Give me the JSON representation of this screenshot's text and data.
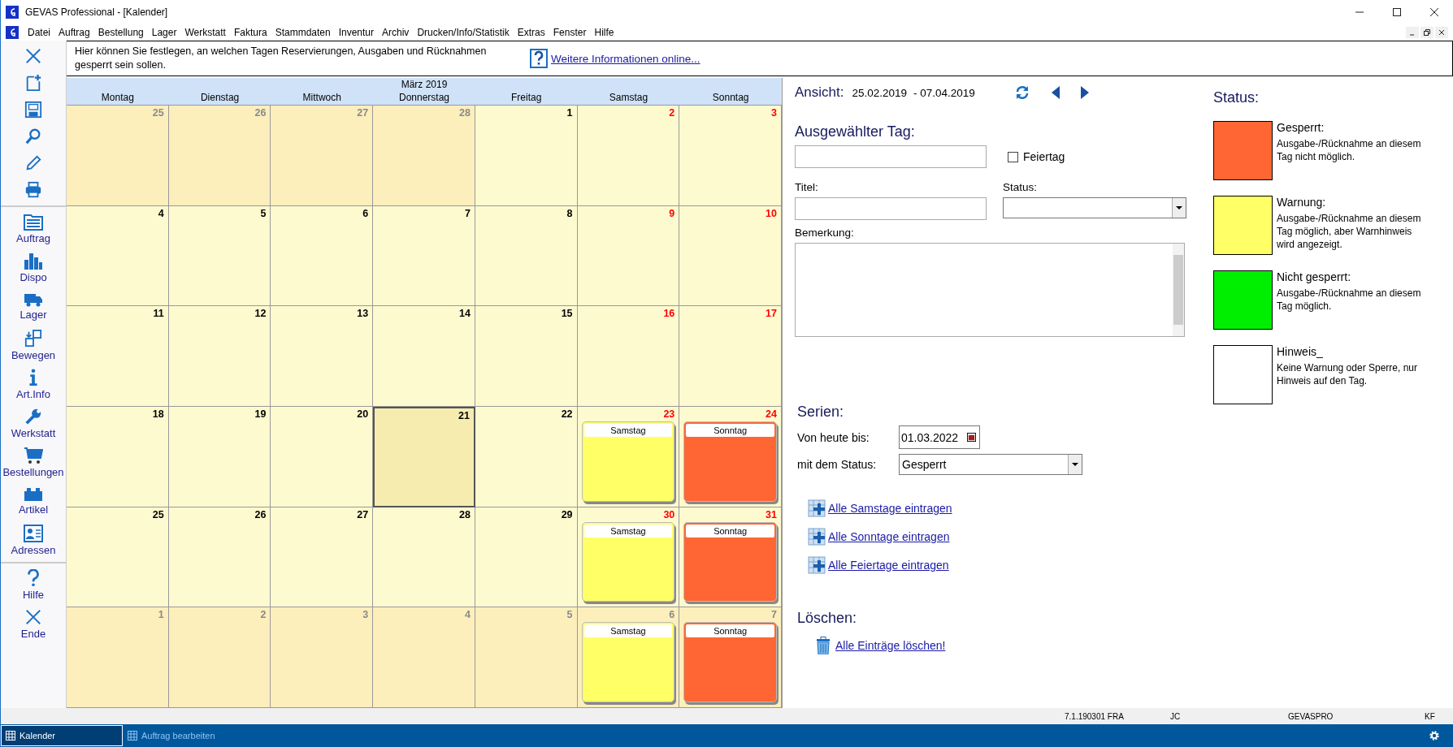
{
  "window": {
    "title": "GEVAS Professional - [Kalender]"
  },
  "menu": [
    {
      "label": "Datei"
    },
    {
      "label": "Auftrag"
    },
    {
      "label": "Bestellung"
    },
    {
      "label": "Lager"
    },
    {
      "label": "Werkstatt"
    },
    {
      "label": "Faktura"
    },
    {
      "label": "Stammdaten"
    },
    {
      "label": "Inventur"
    },
    {
      "label": "Archiv"
    },
    {
      "label": "Drucken/Info/Statistik"
    },
    {
      "label": "Extras"
    },
    {
      "label": "Fenster"
    },
    {
      "label": "Hilfe"
    }
  ],
  "sidebar": {
    "items": [
      {
        "label": "Auftrag"
      },
      {
        "label": "Dispo"
      },
      {
        "label": "Lager"
      },
      {
        "label": "Bewegen"
      },
      {
        "label": "Art.Info"
      },
      {
        "label": "Werkstatt"
      },
      {
        "label": "Bestellungen"
      },
      {
        "label": "Artikel"
      },
      {
        "label": "Adressen"
      }
    ],
    "bottom_items": [
      {
        "label": "Hilfe"
      },
      {
        "label": "Ende"
      }
    ]
  },
  "info_bar": {
    "text": "Hier können Sie festlegen, an welchen Tagen Reservierungen, Ausgaben und Rücknahmen gesperrt sein sollen.",
    "link": "Weitere Informationen online..."
  },
  "calendar": {
    "month": "März 2019",
    "weekdays": [
      "Montag",
      "Dienstag",
      "Mittwoch",
      "Donnerstag",
      "Freitag",
      "Samstag",
      "Sonntag"
    ],
    "weeks": [
      [
        {
          "day": "25",
          "in_month": false,
          "selected": false
        },
        {
          "day": "26",
          "in_month": false,
          "selected": false
        },
        {
          "day": "27",
          "in_month": false,
          "selected": false
        },
        {
          "day": "28",
          "in_month": false,
          "selected": false
        },
        {
          "day": "1",
          "in_month": true,
          "selected": false
        },
        {
          "day": "2",
          "in_month": true,
          "selected": false
        },
        {
          "day": "3",
          "in_month": true,
          "selected": false
        }
      ],
      [
        {
          "day": "4",
          "in_month": true,
          "selected": false
        },
        {
          "day": "5",
          "in_month": true,
          "selected": false
        },
        {
          "day": "6",
          "in_month": true,
          "selected": false
        },
        {
          "day": "7",
          "in_month": true,
          "selected": false
        },
        {
          "day": "8",
          "in_month": true,
          "selected": false
        },
        {
          "day": "9",
          "in_month": true,
          "selected": false
        },
        {
          "day": "10",
          "in_month": true,
          "selected": false
        }
      ],
      [
        {
          "day": "11",
          "in_month": true,
          "selected": false
        },
        {
          "day": "12",
          "in_month": true,
          "selected": false
        },
        {
          "day": "13",
          "in_month": true,
          "selected": false
        },
        {
          "day": "14",
          "in_month": true,
          "selected": false
        },
        {
          "day": "15",
          "in_month": true,
          "selected": false
        },
        {
          "day": "16",
          "in_month": true,
          "selected": false
        },
        {
          "day": "17",
          "in_month": true,
          "selected": false
        }
      ],
      [
        {
          "day": "18",
          "in_month": true,
          "selected": false
        },
        {
          "day": "19",
          "in_month": true,
          "selected": false
        },
        {
          "day": "20",
          "in_month": true,
          "selected": false
        },
        {
          "day": "21",
          "in_month": true,
          "selected": true
        },
        {
          "day": "22",
          "in_month": true,
          "selected": false
        },
        {
          "day": "23",
          "in_month": true,
          "selected": false,
          "entry": {
            "title": "Samstag",
            "color": "#ffff66"
          }
        },
        {
          "day": "24",
          "in_month": true,
          "selected": false,
          "entry": {
            "title": "Sonntag",
            "color": "#ff6633"
          }
        }
      ],
      [
        {
          "day": "25",
          "in_month": true,
          "selected": false
        },
        {
          "day": "26",
          "in_month": true,
          "selected": false
        },
        {
          "day": "27",
          "in_month": true,
          "selected": false
        },
        {
          "day": "28",
          "in_month": true,
          "selected": false
        },
        {
          "day": "29",
          "in_month": true,
          "selected": false
        },
        {
          "day": "30",
          "in_month": true,
          "selected": false,
          "entry": {
            "title": "Samstag",
            "color": "#ffff66"
          }
        },
        {
          "day": "31",
          "in_month": true,
          "selected": false,
          "entry": {
            "title": "Sonntag",
            "color": "#ff6633"
          }
        }
      ],
      [
        {
          "day": "1",
          "in_month": false,
          "selected": false
        },
        {
          "day": "2",
          "in_month": false,
          "selected": false
        },
        {
          "day": "3",
          "in_month": false,
          "selected": false
        },
        {
          "day": "4",
          "in_month": false,
          "selected": false
        },
        {
          "day": "5",
          "in_month": false,
          "selected": false
        },
        {
          "day": "6",
          "in_month": false,
          "selected": false,
          "entry": {
            "title": "Samstag",
            "color": "#ffff66"
          }
        },
        {
          "day": "7",
          "in_month": false,
          "selected": false,
          "entry": {
            "title": "Sonntag",
            "color": "#ff6633"
          }
        }
      ]
    ]
  },
  "view": {
    "label": "Ansicht:",
    "from": "25.02.2019",
    "to": "- 07.04.2019"
  },
  "selected_day": {
    "heading": "Ausgewählter Tag:",
    "holiday": {
      "label": "Feiertag",
      "checked": false
    },
    "title_label": "Titel:",
    "status_label": "Status:",
    "remark_label": "Bemerkung:"
  },
  "series": {
    "heading": "Serien:",
    "until_label": "Von heute bis:",
    "until_value": "01.03.2022",
    "status_label": "mit dem Status:",
    "status_value": "Gesperrt",
    "links": [
      "Alle Samstage eintragen",
      "Alle Sonntage eintragen",
      "Alle Feiertage eintragen"
    ]
  },
  "delete": {
    "heading": "Löschen:",
    "link": "Alle Einträge löschen!"
  },
  "legend": {
    "heading": "Status:",
    "items": [
      {
        "name": "Gesperrt:",
        "description": "Ausgabe-/Rücknahme an diesem Tag nicht möglich.",
        "color": "#ff6633"
      },
      {
        "name": "Warnung:",
        "description": "Ausgabe-/Rücknahme an diesem Tag möglich, aber Warnhinweis wird angezeigt.",
        "color": "#ffff66"
      },
      {
        "name": "Nicht gesperrt:",
        "description": "Ausgabe-/Rücknahme an diesem Tag möglich.",
        "color": "#00ee00"
      },
      {
        "name": "Hinweis_",
        "description": "Keine Warnung oder Sperre, nur Hinweis auf den Tag.",
        "color": "#ffffff"
      }
    ]
  },
  "status_bar": [
    "7.1.190301 FRA",
    "JC",
    "GEVASPRO",
    "KF"
  ],
  "taskbar": [
    {
      "label": "Kalender",
      "selected": true
    },
    {
      "label": "Auftrag bearbeiten",
      "selected": false
    }
  ]
}
